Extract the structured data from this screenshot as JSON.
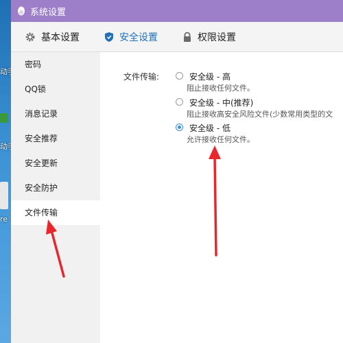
{
  "window": {
    "title": "系统设置"
  },
  "topnav": {
    "tabs": [
      {
        "label": "基本设置",
        "icon": "gear-icon",
        "active": false
      },
      {
        "label": "安全设置",
        "icon": "shield-icon",
        "active": true
      },
      {
        "label": "权限设置",
        "icon": "lock-icon",
        "active": false
      }
    ]
  },
  "sidebar": {
    "items": [
      {
        "label": "密码"
      },
      {
        "label": "QQ锁"
      },
      {
        "label": "消息记录"
      },
      {
        "label": "安全推荐"
      },
      {
        "label": "安全更新"
      },
      {
        "label": "安全防护"
      },
      {
        "label": "文件传输",
        "active": true
      }
    ]
  },
  "file_transfer": {
    "label": "文件传输:",
    "options": [
      {
        "title": "安全级 - 高",
        "desc": "阻止接收任何文件。",
        "checked": false
      },
      {
        "title": "安全级 - 中(推荐)",
        "desc": "阻止接收高安全风险文件(少数常用类型的文",
        "checked": false
      },
      {
        "title": "安全级 - 低",
        "desc": "允许接收任何文件。",
        "checked": true
      }
    ]
  },
  "desktop": {
    "fragments": [
      "动手",
      "动手",
      "re"
    ]
  },
  "colors": {
    "titlebar": "#9c7ec9",
    "accent": "#2170b9",
    "annotation_arrow": "#e8262b"
  }
}
